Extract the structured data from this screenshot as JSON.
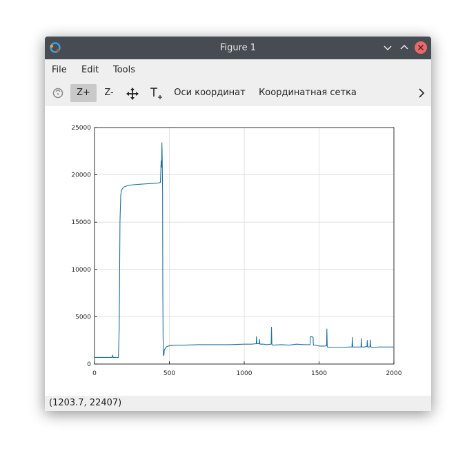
{
  "window": {
    "title": "Figure 1"
  },
  "menu": {
    "items": [
      "File",
      "Edit",
      "Tools"
    ]
  },
  "toolbar": {
    "zoom_in": "Z+",
    "zoom_out": "Z-",
    "axes_label": "Оси координат",
    "grid_label": "Координатная сетка"
  },
  "status": {
    "coords": "(1203.7, 22407)"
  },
  "colors": {
    "line": "#1f6f9e",
    "grid": "#d9d9d9",
    "titlebar": "#474c52",
    "close": "#e8696b"
  },
  "chart_data": {
    "type": "line",
    "title": "",
    "xlabel": "",
    "ylabel": "",
    "xlim": [
      0,
      2000
    ],
    "ylim": [
      0,
      25000
    ],
    "xticks": [
      0,
      500,
      1000,
      1500,
      2000
    ],
    "yticks": [
      0,
      5000,
      10000,
      15000,
      20000,
      25000
    ],
    "grid": true,
    "series": [
      {
        "x": [
          0,
          118,
          120,
          125,
          128,
          160,
          165,
          170,
          172,
          175,
          178,
          180,
          185,
          195,
          210,
          230,
          260,
          300,
          350,
          400,
          430,
          440,
          445,
          448,
          450,
          452,
          454,
          455,
          456,
          458,
          460,
          462,
          464,
          466,
          470,
          480,
          500,
          550,
          600,
          700,
          800,
          900,
          1000,
          1050,
          1080,
          1082,
          1085,
          1100,
          1102,
          1105,
          1130,
          1150,
          1180,
          1182,
          1185,
          1190,
          1250,
          1300,
          1350,
          1400,
          1440,
          1442,
          1460,
          1462,
          1480,
          1500,
          1540,
          1550,
          1552,
          1555,
          1570,
          1600,
          1650,
          1700,
          1720,
          1722,
          1725,
          1750,
          1780,
          1782,
          1785,
          1800,
          1820,
          1822,
          1825,
          1840,
          1842,
          1845,
          1860,
          1900,
          1950,
          2000
        ],
        "y": [
          700,
          700,
          950,
          700,
          700,
          700,
          3800,
          15000,
          16000,
          17800,
          18200,
          18300,
          18500,
          18700,
          18800,
          18900,
          18950,
          19000,
          19050,
          19100,
          19150,
          19200,
          21500,
          20800,
          23400,
          22000,
          19500,
          18000,
          8000,
          3000,
          1000,
          900,
          1000,
          1400,
          1600,
          1800,
          1950,
          2000,
          2000,
          2050,
          2050,
          2050,
          2100,
          2100,
          2150,
          2900,
          2150,
          2150,
          2600,
          2100,
          2100,
          2050,
          2100,
          3900,
          2100,
          2000,
          2050,
          2000,
          2100,
          2050,
          2050,
          2900,
          2850,
          2000,
          2000,
          1900,
          1900,
          1950,
          3700,
          1800,
          1750,
          1750,
          1750,
          1800,
          1800,
          2800,
          1800,
          1800,
          1800,
          2700,
          1800,
          1800,
          1850,
          2500,
          1800,
          1800,
          2550,
          1800,
          1750,
          1800,
          1800,
          1800
        ]
      }
    ]
  }
}
